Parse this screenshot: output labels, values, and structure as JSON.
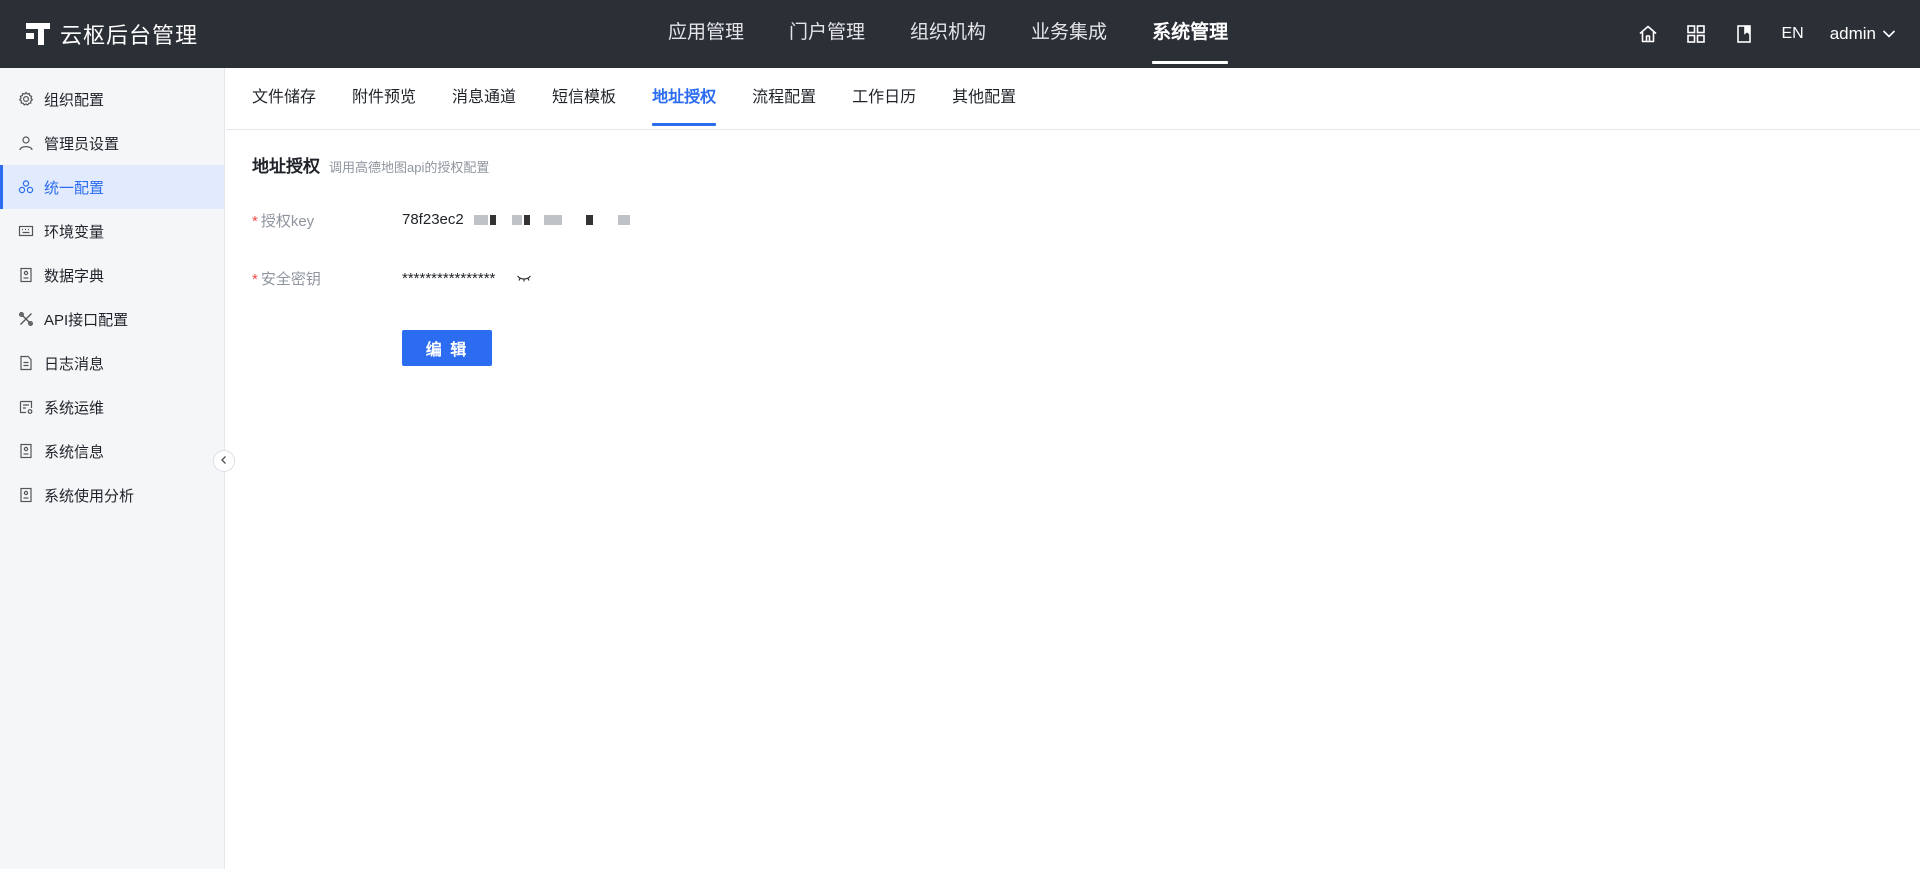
{
  "brand": {
    "name": "云枢后台管理"
  },
  "topnav": [
    {
      "label": "应用管理",
      "active": false
    },
    {
      "label": "门户管理",
      "active": false
    },
    {
      "label": "组织机构",
      "active": false
    },
    {
      "label": "业务集成",
      "active": false
    },
    {
      "label": "系统管理",
      "active": true
    }
  ],
  "topright": {
    "lang": "EN",
    "user": "admin"
  },
  "sidebar": {
    "items": [
      {
        "label": "组织配置",
        "icon": "gear-icon"
      },
      {
        "label": "管理员设置",
        "icon": "user-icon"
      },
      {
        "label": "统一配置",
        "icon": "config-icon",
        "active": true
      },
      {
        "label": "环境变量",
        "icon": "keyboard-icon"
      },
      {
        "label": "数据字典",
        "icon": "document-icon"
      },
      {
        "label": "API接口配置",
        "icon": "tools-icon"
      },
      {
        "label": "日志消息",
        "icon": "log-icon"
      },
      {
        "label": "系统运维",
        "icon": "ops-icon"
      },
      {
        "label": "系统信息",
        "icon": "info-doc-icon"
      },
      {
        "label": "系统使用分析",
        "icon": "analysis-icon"
      }
    ]
  },
  "tabs": [
    {
      "label": "文件储存"
    },
    {
      "label": "附件预览"
    },
    {
      "label": "消息通道"
    },
    {
      "label": "短信模板"
    },
    {
      "label": "地址授权",
      "active": true
    },
    {
      "label": "流程配置"
    },
    {
      "label": "工作日历"
    },
    {
      "label": "其他配置"
    }
  ],
  "section": {
    "title": "地址授权",
    "desc": "调用高德地图api的授权配置"
  },
  "form": {
    "required_mark": "*",
    "key_label": "授权key",
    "key_value": "78f23ec2",
    "secret_label": "安全密钥",
    "secret_value": "****************"
  },
  "actions": {
    "edit_label": "编 辑"
  },
  "colors": {
    "topbar": "#2b2f36",
    "accent": "#2b6cf0",
    "sidebar_bg": "#f4f6f8",
    "required": "#f54a45"
  }
}
